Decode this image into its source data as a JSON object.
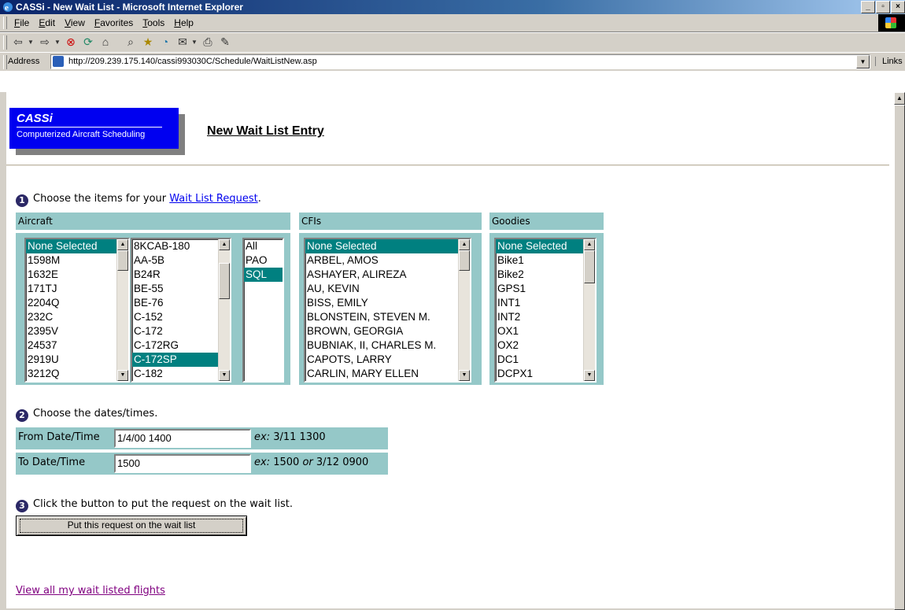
{
  "window": {
    "title": "CASSi - New Wait List - Microsoft Internet Explorer",
    "min": "_",
    "max": "▫",
    "close": "×"
  },
  "menu": [
    "File",
    "Edit",
    "View",
    "Favorites",
    "Tools",
    "Help"
  ],
  "address": {
    "label": "Address",
    "url": "http://209.239.175.140/cassi993030C/Schedule/WaitListNew.asp",
    "links": "Links"
  },
  "logo": {
    "name": "CASSi",
    "tagline": "Computerized Aircraft Scheduling"
  },
  "page_title": "New Wait List Entry",
  "step1": {
    "num": "1",
    "text": "Choose the items for your ",
    "link": "Wait List Request",
    "after": "."
  },
  "headers": {
    "aircraft": "Aircraft",
    "cfis": "CFIs",
    "goodies": "Goodies"
  },
  "aircraft_tail": [
    "None Selected",
    "1598M",
    "1632E",
    "171TJ",
    "2204Q",
    "232C",
    "2395V",
    "24537",
    "2919U",
    "3212Q"
  ],
  "aircraft_type": [
    "8KCAB-180",
    "AA-5B",
    "B24R",
    "BE-55",
    "BE-76",
    "C-152",
    "C-172",
    "C-172RG",
    "C-172SP",
    "C-182"
  ],
  "aircraft_base": [
    "All",
    "PAO",
    "SQL"
  ],
  "cfis": [
    "None Selected",
    "ARBEL, AMOS",
    "ASHAYER, ALIREZA",
    "AU, KEVIN",
    "BISS, EMILY",
    "BLONSTEIN, STEVEN M.",
    "BROWN, GEORGIA",
    "BUBNIAK, II, CHARLES M.",
    "CAPOTS, LARRY",
    "CARLIN, MARY ELLEN"
  ],
  "goodies": [
    "None Selected",
    "Bike1",
    "Bike2",
    "GPS1",
    "INT1",
    "INT2",
    "OX1",
    "OX2",
    "DC1",
    "DCPX1"
  ],
  "step2": {
    "num": "2",
    "text": "Choose the dates/times."
  },
  "from": {
    "label": "From Date/Time",
    "value": "1/4/00 1400",
    "ex_label": "ex:",
    "ex_value": " 3/11 1300"
  },
  "to": {
    "label": "To Date/Time",
    "value": "1500",
    "ex_label": "ex:",
    "ex_value_a": " 1500 ",
    "ex_or": "or",
    "ex_value_b": " 3/12 0900"
  },
  "step3": {
    "num": "3",
    "text": "Click the button to put the request on the wait list."
  },
  "submit_label": "Put this request on the wait list",
  "view_all": "View all my wait listed flights"
}
